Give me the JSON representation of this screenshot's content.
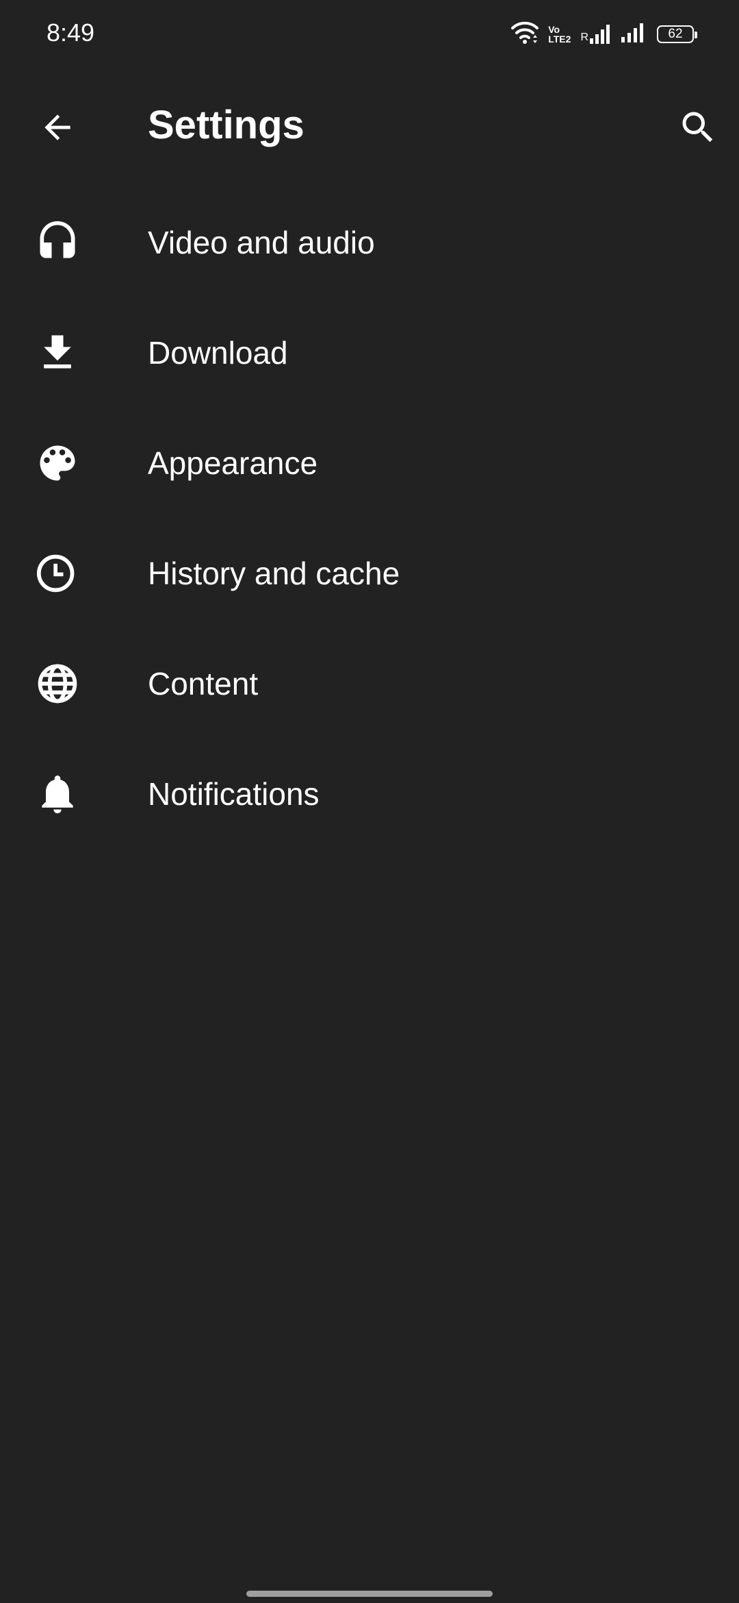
{
  "status_bar": {
    "time": "8:49",
    "volte_top": "Vo",
    "volte_bottom": "LTE2",
    "roaming": "R",
    "battery": "62",
    "icons": [
      "wifi-icon",
      "volte-icon",
      "signal-icon",
      "signal-icon",
      "battery-icon"
    ]
  },
  "toolbar": {
    "title": "Settings",
    "back_icon": "arrow-back-icon",
    "search_icon": "search-icon"
  },
  "settings": {
    "items": [
      {
        "label": "Video and audio",
        "icon": "headphones-icon"
      },
      {
        "label": "Download",
        "icon": "download-icon"
      },
      {
        "label": "Appearance",
        "icon": "palette-icon"
      },
      {
        "label": "History and cache",
        "icon": "history-icon"
      },
      {
        "label": "Content",
        "icon": "globe-icon"
      },
      {
        "label": "Notifications",
        "icon": "bell-icon"
      }
    ]
  },
  "colors": {
    "background": "#222222",
    "foreground": "#ffffff",
    "gesture_bar": "#9e9e9e"
  }
}
